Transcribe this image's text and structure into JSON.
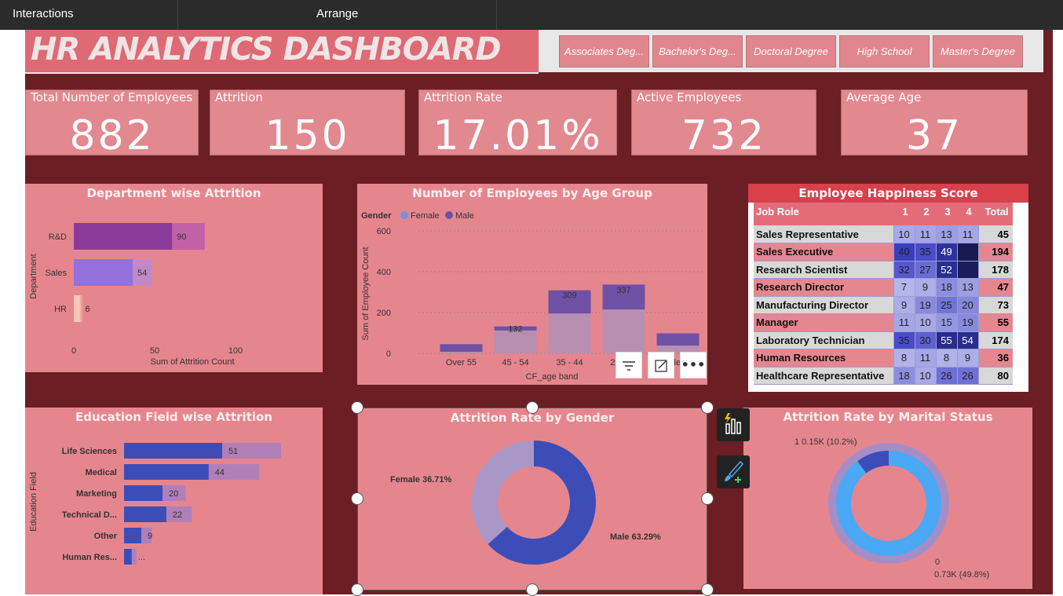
{
  "menu": {
    "interactions": "Interactions",
    "arrange": "Arrange"
  },
  "title": "HR ANALYTICS DASHBOARD",
  "education_slicer": [
    "Associates Deg...",
    "Bachelor's Deg...",
    "Doctoral Degree",
    "High School",
    "Master's Degree"
  ],
  "kpis": [
    {
      "label": "Total Number of Employees",
      "value": "882"
    },
    {
      "label": "Attrition",
      "value": "150"
    },
    {
      "label": "Attrition Rate",
      "value": "17.01%"
    },
    {
      "label": "Active Employees",
      "value": "732"
    },
    {
      "label": "Average Age",
      "value": "37"
    }
  ],
  "colors": {
    "canvas": "#6b1f24",
    "panel": "#e5868e",
    "female": "#7b8de0",
    "male": "#6e51a4",
    "blue": "#3d4db8",
    "light_blue": "#4aa8f5"
  },
  "chart_data": [
    {
      "type": "bar",
      "title": "Department wise Attrition",
      "xlabel": "Sum of Attrition Count",
      "ylabel": "Department",
      "categories": [
        "R&D",
        "Sales",
        "HR"
      ],
      "values": [
        90,
        54,
        6
      ],
      "xticks": [
        "0",
        "50",
        "100"
      ],
      "xlim": [
        0,
        135
      ]
    },
    {
      "type": "bar",
      "title": "Number of Employees by Age Group",
      "legend_title": "Gender",
      "legend": [
        "Female",
        "Male"
      ],
      "xlabel": "CF_age band",
      "ylabel": "Sum of Employee Count",
      "categories": [
        "Over 55",
        "45 - 54",
        "35 - 44",
        "25 - 34",
        "Under 25"
      ],
      "series": [
        {
          "name": "Female",
          "values": [
            8,
            112,
            195,
            215,
            38
          ]
        },
        {
          "name": "Male",
          "values": [
            37,
            20,
            114,
            122,
            60
          ]
        }
      ],
      "totals": [
        45,
        132,
        309,
        337,
        98
      ],
      "labels": [
        "",
        "132",
        "309",
        "337",
        ""
      ],
      "yticks": [
        "0",
        "200",
        "400",
        "600"
      ],
      "ylim": [
        0,
        650
      ]
    },
    {
      "type": "bar",
      "title": "Education Field wise Attrition",
      "ylabel": "Education Field",
      "categories": [
        "Life Sciences",
        "Medical",
        "Marketing",
        "Technical D...",
        "Other",
        "Human Res..."
      ],
      "values": [
        51,
        44,
        20,
        22,
        9,
        4
      ],
      "labels": [
        "51",
        "44",
        "20",
        "22",
        "9",
        "..."
      ],
      "xlim": [
        0,
        80
      ]
    },
    {
      "type": "pie",
      "title": "Attrition Rate by Gender",
      "slices": [
        {
          "name": "Female",
          "value": 36.71,
          "label": "Female 36.71%"
        },
        {
          "name": "Male",
          "value": 63.29,
          "label": "Male 63.29%"
        }
      ]
    },
    {
      "type": "pie",
      "title": "Attrition Rate by Marital Status",
      "slices": [
        {
          "name": "1",
          "value": 10.2,
          "label": "1 0.15K (10.2%)"
        },
        {
          "name": "0",
          "value": 49.8,
          "label": "0.73K (49.8%)"
        }
      ],
      "label_zero": "0"
    }
  ],
  "happiness": {
    "title": "Employee Happiness Score",
    "headers": [
      "Job Role",
      "1",
      "2",
      "3",
      "4",
      "Total"
    ],
    "rows": [
      {
        "role": "Sales Representative",
        "v": [
          "10",
          "11",
          "13",
          "11"
        ],
        "total": "45"
      },
      {
        "role": "Sales Executive",
        "v": [
          "40",
          "35",
          "49",
          ""
        ],
        "total": "194"
      },
      {
        "role": "Research Scientist",
        "v": [
          "32",
          "27",
          "52",
          ""
        ],
        "total": "178"
      },
      {
        "role": "Research Director",
        "v": [
          "7",
          "9",
          "18",
          "13"
        ],
        "total": "47"
      },
      {
        "role": "Manufacturing Director",
        "v": [
          "9",
          "19",
          "25",
          "20"
        ],
        "total": "73"
      },
      {
        "role": "Manager",
        "v": [
          "11",
          "10",
          "15",
          "19"
        ],
        "total": "55"
      },
      {
        "role": "Laboratory Technician",
        "v": [
          "35",
          "30",
          "55",
          "54"
        ],
        "total": "174"
      },
      {
        "role": "Human Resources",
        "v": [
          "8",
          "11",
          "8",
          "9"
        ],
        "total": "36"
      },
      {
        "role": "Healthcare Representative",
        "v": [
          "18",
          "10",
          "26",
          "26"
        ],
        "total": "80"
      }
    ],
    "cell_levels": [
      [
        10,
        11,
        13,
        11
      ],
      [
        40,
        35,
        49,
        70
      ],
      [
        32,
        27,
        52,
        67
      ],
      [
        7,
        9,
        18,
        13
      ],
      [
        9,
        19,
        25,
        20
      ],
      [
        11,
        10,
        15,
        19
      ],
      [
        35,
        30,
        55,
        54
      ],
      [
        8,
        11,
        8,
        9
      ],
      [
        18,
        10,
        26,
        26
      ]
    ]
  }
}
